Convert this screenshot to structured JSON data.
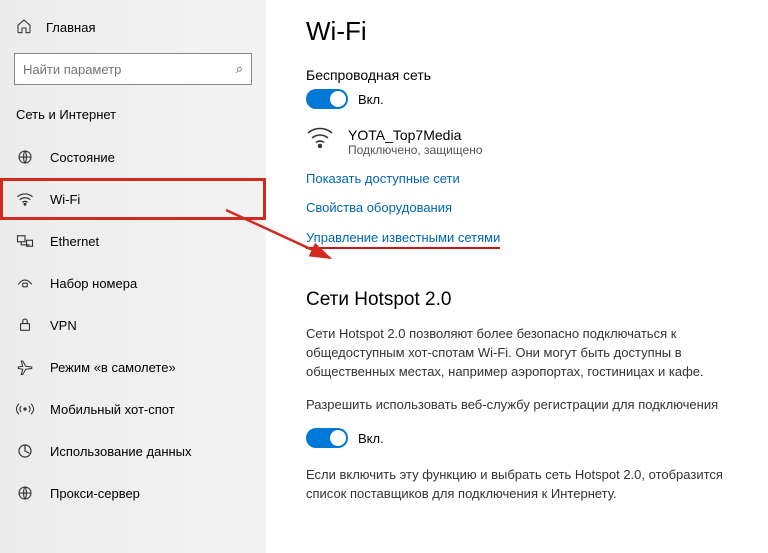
{
  "sidebar": {
    "home": "Главная",
    "search_placeholder": "Найти параметр",
    "section": "Сеть и Интернет",
    "items": [
      {
        "label": "Состояние"
      },
      {
        "label": "Wi-Fi"
      },
      {
        "label": "Ethernet"
      },
      {
        "label": "Набор номера"
      },
      {
        "label": "VPN"
      },
      {
        "label": "Режим «в самолете»"
      },
      {
        "label": "Мобильный хот-спот"
      },
      {
        "label": "Использование данных"
      },
      {
        "label": "Прокси-сервер"
      }
    ]
  },
  "main": {
    "title": "Wi-Fi",
    "wireless_label": "Беспроводная сеть",
    "toggle1_state": "Вкл.",
    "network_name": "YOTA_Top7Media",
    "network_status": "Подключено, защищено",
    "link_show_networks": "Показать доступные сети",
    "link_hw_properties": "Свойства оборудования",
    "link_manage_networks": "Управление известными сетями",
    "hotspot_title": "Сети Hotspot 2.0",
    "hotspot_desc": "Сети Hotspot 2.0 позволяют более безопасно подключаться к общедоступным хот-спотам Wi-Fi. Они могут быть доступны в общественных местах, например аэропортах, гостиницах и кафе.",
    "hotspot_allow": "Разрешить использовать веб-службу регистрации для подключения",
    "toggle2_state": "Вкл.",
    "hotspot_note": "Если включить эту функцию и выбрать сеть Hotspot 2.0, отобразится список поставщиков для подключения к Интернету."
  }
}
